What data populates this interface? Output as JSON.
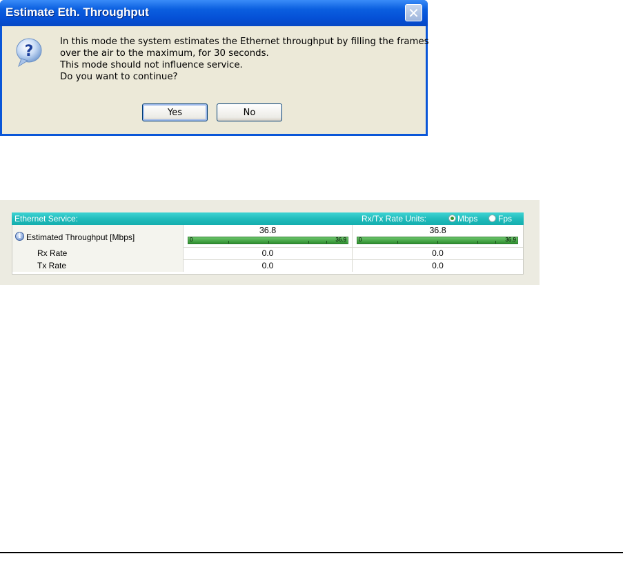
{
  "dialog": {
    "title": "Estimate Eth. Throughput",
    "message_lines": [
      "In this mode the system estimates the Ethernet throughput by filling the frames",
      "over the air to the maximum, for 30 seconds.",
      "This mode should not influence service.",
      "Do you want to continue?"
    ],
    "yes_label": "Yes",
    "no_label": "No",
    "close_glyph": "✕",
    "icon": "question-icon"
  },
  "ethernet": {
    "header_title": "Ethernet Service:",
    "units_label": "Rx/Tx Rate Units:",
    "unit_options": [
      {
        "label": "Mbps",
        "selected": true
      },
      {
        "label": "Fps",
        "selected": false
      }
    ],
    "rows": {
      "throughput": {
        "label": "Estimated Throughput [Mbps]",
        "icon": "info-icon",
        "values": [
          "36.8",
          "36.8"
        ],
        "bar_min": "0",
        "bar_max": "36.9",
        "fill_fraction": 0.997
      },
      "rx": {
        "label": "Rx Rate",
        "values": [
          "0.0",
          "0.0"
        ]
      },
      "tx": {
        "label": "Tx Rate",
        "values": [
          "0.0",
          "0.0"
        ]
      }
    }
  },
  "colors": {
    "titlebar": "#0550d6",
    "dialog_bg": "#ece9d8",
    "header_teal": "#21bcbc",
    "bar_green": "#3fa33f"
  }
}
